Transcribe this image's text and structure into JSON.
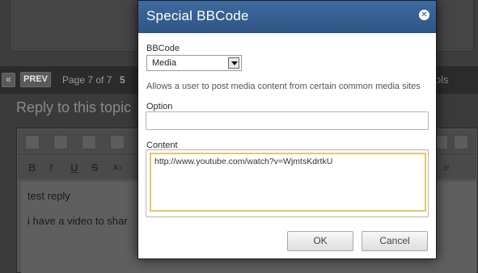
{
  "background": {
    "pagination": {
      "first_label": "«",
      "prev_label": "PREV",
      "page_info": "Page 7 of 7",
      "page_number": "5",
      "tools_fragment": "ols"
    },
    "reply_title": "Reply to this topic",
    "editor": {
      "toolbar_row2": [
        "B",
        "I",
        "U",
        "S",
        "x₂",
        "≡"
      ],
      "lines": [
        "test reply",
        "i have a video to shar"
      ]
    }
  },
  "dialog": {
    "title": "Special BBCode",
    "close_icon": "✕",
    "bbcode_label": "BBCode",
    "bbcode_value": "Media",
    "help_text": "Allows a user to post media content from certain common media sites",
    "option_label": "Option",
    "option_value": "",
    "content_label": "Content",
    "content_value": "http://www.youtube.com/watch?v=WjmtsKdrtkU",
    "ok_label": "OK",
    "cancel_label": "Cancel"
  },
  "colors": {
    "header": "#2e5583",
    "focus_border": "#e8c46a",
    "overlay": "#3a3a3a"
  }
}
